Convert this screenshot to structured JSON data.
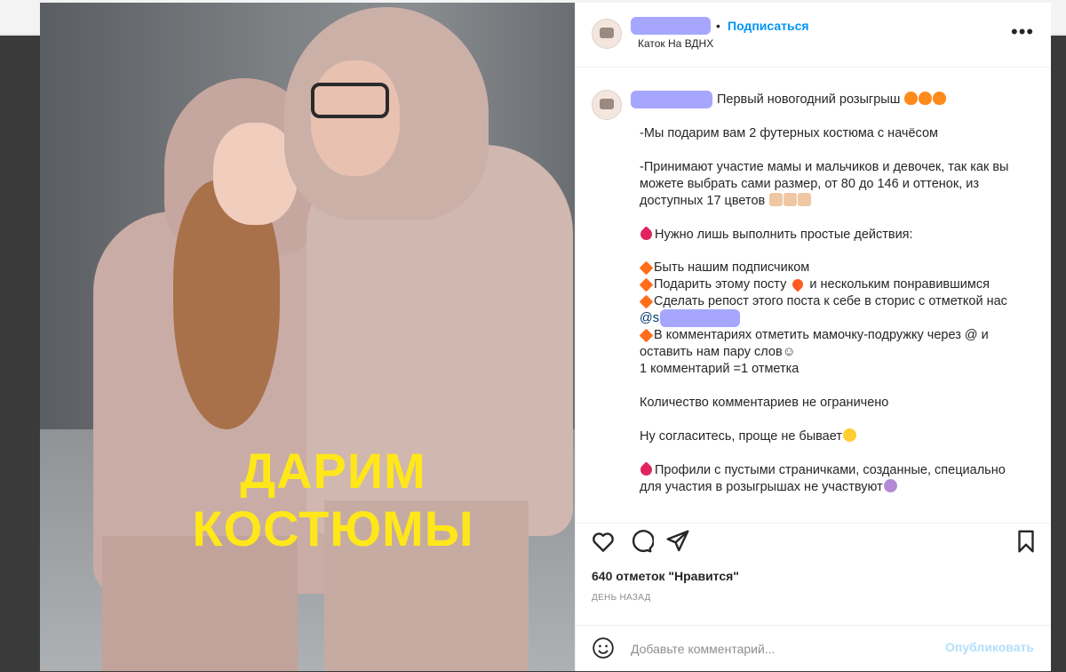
{
  "header": {
    "follow_label": "Подписаться",
    "separator": "•",
    "location": "Каток На ВДНХ",
    "more_glyph": "•••"
  },
  "photo": {
    "overlay_text": "ДАРИМ КОСТЮМЫ"
  },
  "caption": {
    "title": "Первый новогодний розыгрыш",
    "lines": [
      "-Мы подарим вам 2 футерных костюма с начёсом",
      "-Принимают участие мамы и мальчиков и девочек, так как вы",
      "можете выбрать сами размер, от 80 до 146 и оттенок, из",
      "доступных 17 цветов",
      "Нужно лишь выполнить простые действия:",
      "Быть нашим подписчиком",
      "Подарить этому посту",
      "и нескольким понравившимся",
      "Сделать репост этого поста к себе в сторис с отметкой нас",
      "@su",
      "В комментариях отметить мамочку-подружку через @ и",
      "оставить нам пару слов☺",
      "1 комментарий =1 отметка",
      "Количество комментариев не ограничено",
      "Ну согласитесь, проще не бывает",
      "Профили с пустыми страничками, созданные, специально",
      "для участия в розыгрышах не участвуют"
    ]
  },
  "actions": {
    "like_icon": "heart-icon",
    "comment_icon": "comment-icon",
    "share_icon": "paper-plane-icon",
    "save_icon": "bookmark-icon"
  },
  "stats": {
    "likes": "640 отметок \"Нравится\"",
    "time": "ДЕНЬ НАЗАД"
  },
  "comment": {
    "placeholder": "Добавьте комментарий...",
    "publish_label": "Опубликовать"
  }
}
